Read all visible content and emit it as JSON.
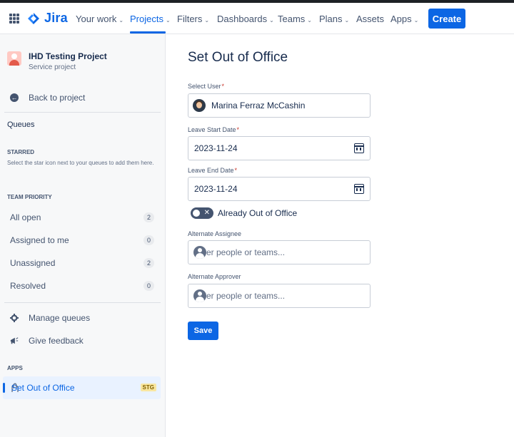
{
  "nav": {
    "product": "Jira",
    "your_work": "Your work",
    "projects": "Projects",
    "filters": "Filters",
    "dashboards": "Dashboards",
    "teams": "Teams",
    "plans": "Plans",
    "assets": "Assets",
    "apps": "Apps",
    "create": "Create",
    "chevron": "⌄"
  },
  "sidebar": {
    "project_name": "IHD Testing Project",
    "project_type": "Service project",
    "back": "Back to project",
    "queues_title": "Queues",
    "starred_heading": "STARRED",
    "starred_note": "Select the star icon next to your queues to add them here.",
    "team_priority_heading": "TEAM PRIORITY",
    "queues": [
      {
        "label": "All open",
        "count": "2"
      },
      {
        "label": "Assigned to me",
        "count": "0"
      },
      {
        "label": "Unassigned",
        "count": "2"
      },
      {
        "label": "Resolved",
        "count": "0"
      }
    ],
    "manage_queues": "Manage queues",
    "give_feedback": "Give feedback",
    "apps_heading": "APPS",
    "app_item": "Set Out of Office",
    "app_lozenge": "STG"
  },
  "form": {
    "title": "Set Out of Office",
    "select_user_label": "Select User",
    "select_user_value": "Marina Ferraz McCashin",
    "leave_start_label": "Leave Start Date",
    "leave_start_value": "2023-11-24",
    "leave_end_label": "Leave End Date",
    "leave_end_value": "2023-11-24",
    "required_mark": "*",
    "out_of_office_toggle": "Already Out of Office",
    "toggle_state": "off",
    "alternate_assignee_label": "Alternate Assignee",
    "alternate_assignee_placeholder": "er people or teams...",
    "alternate_approver_label": "Alternate Approver",
    "alternate_approver_placeholder": "er people or teams...",
    "save": "Save"
  },
  "colors": {
    "brand": "#0c66e4",
    "lozenge_bg": "#f8e6a0"
  },
  "icons": [
    "app-switcher-icon",
    "jira-logo-icon",
    "calendar-icon",
    "person-icon",
    "gear-icon",
    "megaphone-icon",
    "arrow-left-icon"
  ]
}
